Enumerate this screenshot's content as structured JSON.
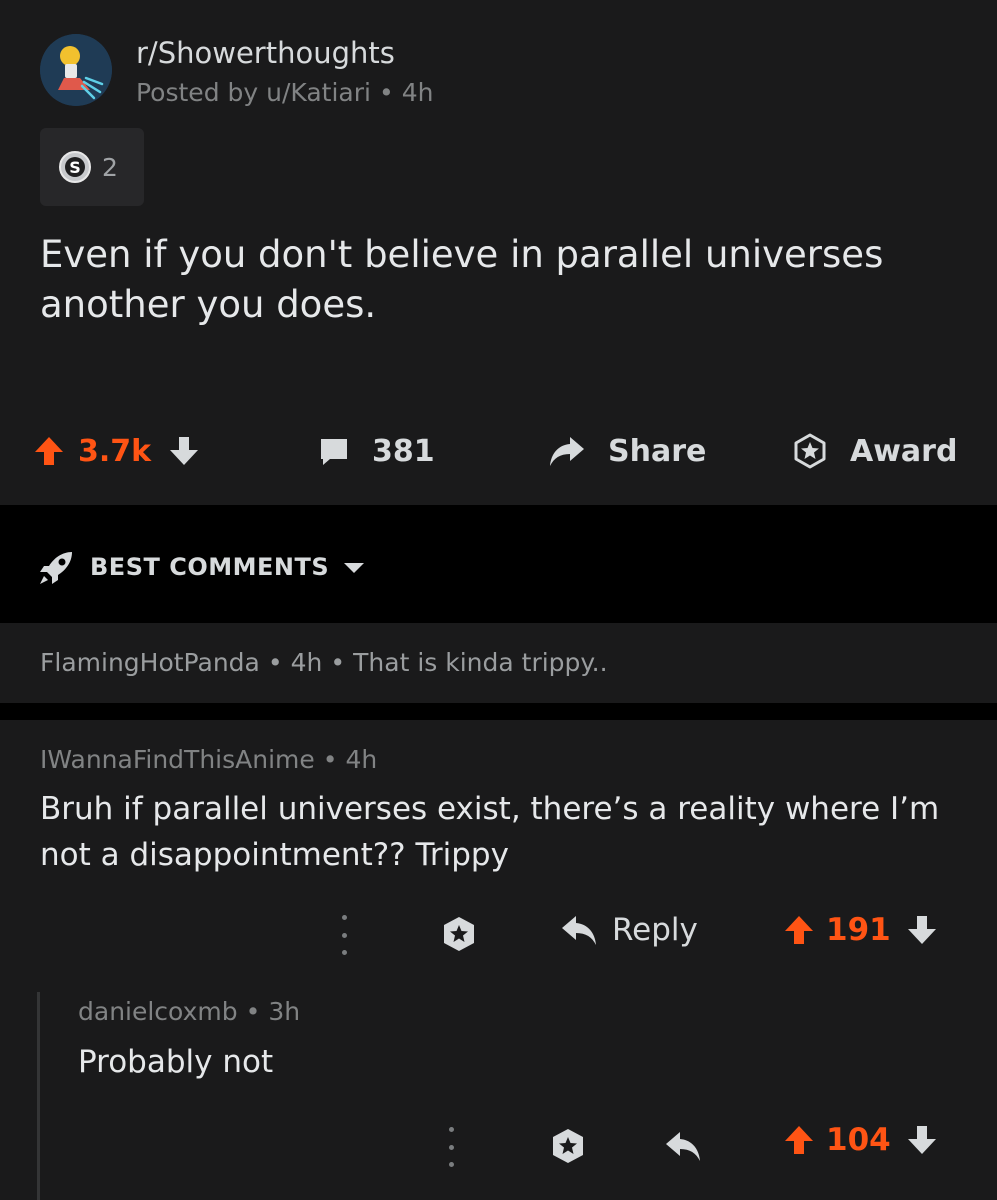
{
  "post": {
    "subreddit": "r/Showerthoughts",
    "posted_by_prefix": "Posted by",
    "author": "u/Katiari",
    "separator": "•",
    "age": "4h",
    "award_count": "2",
    "title": "Even if you don't believe in parallel universes another you does.",
    "score": "3.7k",
    "comment_count": "381",
    "share_label": "Share",
    "award_label": "Award"
  },
  "sort": {
    "label": "BEST COMMENTS"
  },
  "collapsed_comment": {
    "author": "FlamingHotPanda",
    "age": "4h",
    "preview": "That is kinda trippy.."
  },
  "comments": [
    {
      "author": "IWannaFindThisAnime",
      "age": "4h",
      "body": "Bruh if parallel universes exist, there’s a reality where I’m not a disappointment?? Trippy",
      "reply_label": "Reply",
      "score": "191"
    },
    {
      "author": "danielcoxmb",
      "age": "3h",
      "body": "Probably not",
      "score": "104"
    }
  ],
  "colors": {
    "upvote": "#ff5414",
    "background": "#1a1a1b",
    "band": "#000000"
  },
  "icons": [
    "subreddit-avatar-icon",
    "award-silver-icon",
    "upvote-arrow-icon",
    "downvote-arrow-icon",
    "comment-bubble-icon",
    "share-arrow-icon",
    "award-star-icon",
    "rocket-icon",
    "caret-down-icon",
    "more-dots-icon",
    "reply-arrow-icon"
  ]
}
